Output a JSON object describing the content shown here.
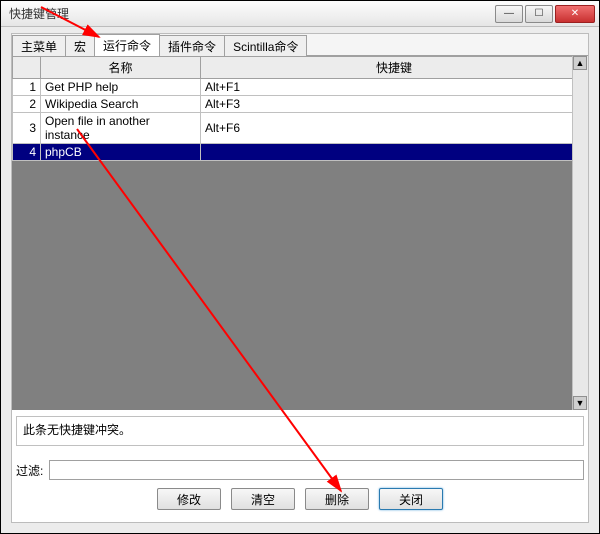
{
  "window": {
    "title": "快捷键管理"
  },
  "tabs": [
    {
      "label": "主菜单"
    },
    {
      "label": "宏"
    },
    {
      "label": "运行命令"
    },
    {
      "label": "插件命令"
    },
    {
      "label": "Scintilla命令"
    }
  ],
  "columns": {
    "idx": "",
    "name": "名称",
    "shortcut": "快捷键"
  },
  "rows": [
    {
      "idx": "1",
      "name": "Get PHP help",
      "shortcut": "Alt+F1"
    },
    {
      "idx": "2",
      "name": "Wikipedia Search",
      "shortcut": "Alt+F3"
    },
    {
      "idx": "3",
      "name": "Open file in another instance",
      "shortcut": "Alt+F6"
    },
    {
      "idx": "4",
      "name": "phpCB",
      "shortcut": ""
    }
  ],
  "status": "此条无快捷键冲突。",
  "filter": {
    "label": "过滤:",
    "value": ""
  },
  "buttons": {
    "modify": "修改",
    "clear": "清空",
    "delete": "删除",
    "close": "关闭"
  },
  "winctrl": {
    "min": "—",
    "max": "☐",
    "close": "✕"
  },
  "scroll": {
    "up": "▲",
    "down": "▼"
  }
}
